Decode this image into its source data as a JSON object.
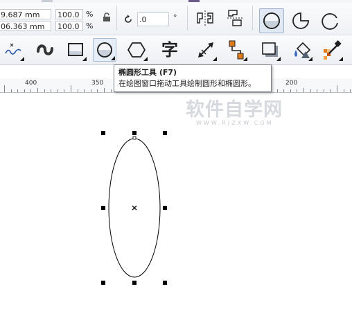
{
  "property_bar": {
    "width_value": "9.687 mm",
    "height_value": "06.363 mm",
    "scale_x": "100.0",
    "scale_y": "100.0",
    "percent_symbol": "%",
    "rotation_value": ".0",
    "degree_symbol": "°"
  },
  "toolbox": {
    "tools": [
      {
        "name": "freehand-tool-icon"
      },
      {
        "name": "smart-drawing-tool-icon"
      },
      {
        "name": "rectangle-tool-icon"
      },
      {
        "name": "ellipse-tool-icon",
        "active": true
      },
      {
        "name": "polygon-tool-icon"
      },
      {
        "name": "text-tool-icon",
        "glyph": "字"
      },
      {
        "name": "dimension-tool-icon"
      },
      {
        "name": "connector-tool-icon"
      },
      {
        "name": "drop-shadow-tool-icon"
      },
      {
        "name": "fill-tool-icon"
      },
      {
        "name": "eyedropper-tool-icon"
      }
    ]
  },
  "ruler": {
    "labels": [
      "400",
      "350",
      "200"
    ]
  },
  "tooltip": {
    "title": "椭圆形工具 (F7)",
    "description": "在绘图窗口拖动工具绘制圆形和椭圆形。"
  },
  "watermark": {
    "text": "软件自学网",
    "sub": "WWW.RJZXW.COM"
  },
  "colors": {
    "accent": "#4a6fa5",
    "orange": "#e07b1a",
    "selection": "#000000"
  }
}
